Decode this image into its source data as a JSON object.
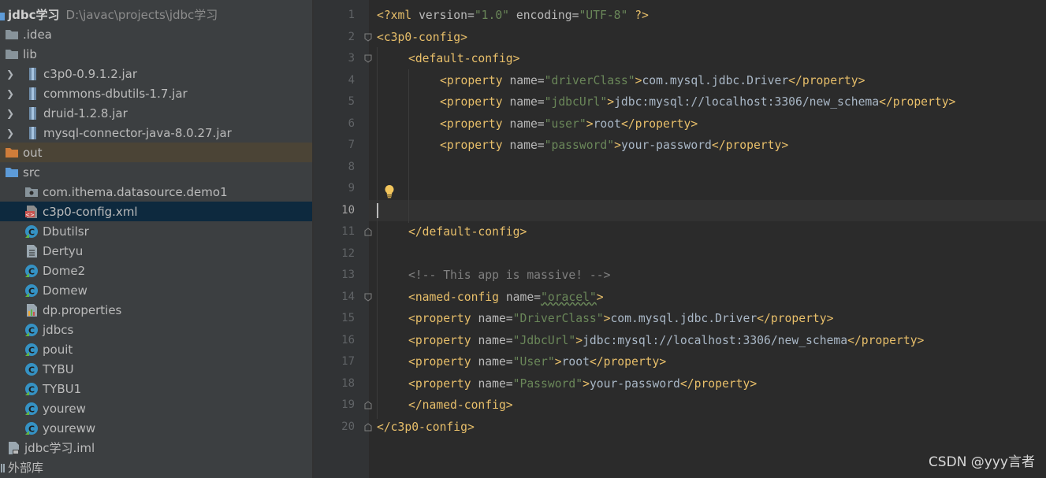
{
  "project": {
    "name": "jdbc学习",
    "path": "D:\\javac\\projects\\jdbc学习"
  },
  "tree": [
    {
      "label": ".idea",
      "icon": "folder-icon"
    },
    {
      "label": "lib",
      "icon": "folder-icon"
    },
    {
      "label": "c3p0-0.9.1.2.jar",
      "icon": "jar-icon"
    },
    {
      "label": "commons-dbutils-1.7.jar",
      "icon": "jar-icon"
    },
    {
      "label": "druid-1.2.8.jar",
      "icon": "jar-icon"
    },
    {
      "label": "mysql-connector-java-8.0.27.jar",
      "icon": "jar-icon"
    },
    {
      "label": "out",
      "icon": "folder-icon"
    },
    {
      "label": "src",
      "icon": "folder-icon"
    },
    {
      "label": "com.ithema.datasource.demo1",
      "icon": "package-icon"
    },
    {
      "label": "c3p0-config.xml",
      "icon": "xml-file-icon"
    },
    {
      "label": "Dbutilsr",
      "icon": "java-class-icon"
    },
    {
      "label": "Dertyu",
      "icon": "text-file-icon"
    },
    {
      "label": "Dome2",
      "icon": "java-class-icon"
    },
    {
      "label": "Domew",
      "icon": "java-class-icon"
    },
    {
      "label": "dp.properties",
      "icon": "properties-file-icon"
    },
    {
      "label": "jdbcs",
      "icon": "java-class-icon"
    },
    {
      "label": "pouit",
      "icon": "java-class-icon"
    },
    {
      "label": "TYBU",
      "icon": "java-class-icon"
    },
    {
      "label": "TYBU1",
      "icon": "java-class-icon"
    },
    {
      "label": "yourew",
      "icon": "java-class-icon"
    },
    {
      "label": "youreww",
      "icon": "java-class-icon"
    },
    {
      "label": "jdbc学习.iml",
      "icon": "iml-file-icon"
    },
    {
      "label": "外部库",
      "icon": "library-icon"
    }
  ],
  "editor": {
    "line_numbers": [
      "1",
      "2",
      "3",
      "4",
      "5",
      "6",
      "7",
      "8",
      "9",
      "10",
      "11",
      "12",
      "13",
      "14",
      "15",
      "16",
      "17",
      "18",
      "19",
      "20"
    ],
    "current_line": "10",
    "t": {
      "xml_decl": "<?xml",
      "version_attr": "version=",
      "version_val": "\"1.0\"",
      "encoding_attr": "encoding=",
      "encoding_val": "\"UTF-8\"",
      "decl_end": "?>",
      "c3p0_open": "<c3p0-config>",
      "default_open": "<default-config>",
      "prop_open": "<property",
      "name_attr": "name=",
      "gt": ">",
      "prop_close": "</property>",
      "v_driverClass": "\"driverClass\"",
      "t_driver": "com.mysql.jdbc.Driver",
      "v_jdbcUrl": "\"jdbcUrl\"",
      "t_url": "jdbc:mysql://localhost:3306/new_schema",
      "v_user": "\"user\"",
      "t_root": "root",
      "v_password": "\"password\"",
      "t_pw": "your-password",
      "default_close": "</default-config>",
      "comment": "<!-- This app is massive! -->",
      "named_open": "<named-config",
      "v_oracel": "\"oracel\"",
      "v_DriverClass": "\"DriverClass\"",
      "v_JdbcUrl": "\"JdbcUrl\"",
      "v_User": "\"User\"",
      "v_Password": "\"Password\"",
      "named_close": "</named-config>",
      "c3p0_close": "</c3p0-config>"
    }
  },
  "watermark": "CSDN @yyy言者",
  "colors": {
    "sidebar_bg": "#3c3f41",
    "editor_bg": "#2b2b2b",
    "tag": "#e8bf6a",
    "string": "#6a8759",
    "attribute": "#bababa",
    "text": "#a9b7c6",
    "comment": "#808080"
  }
}
